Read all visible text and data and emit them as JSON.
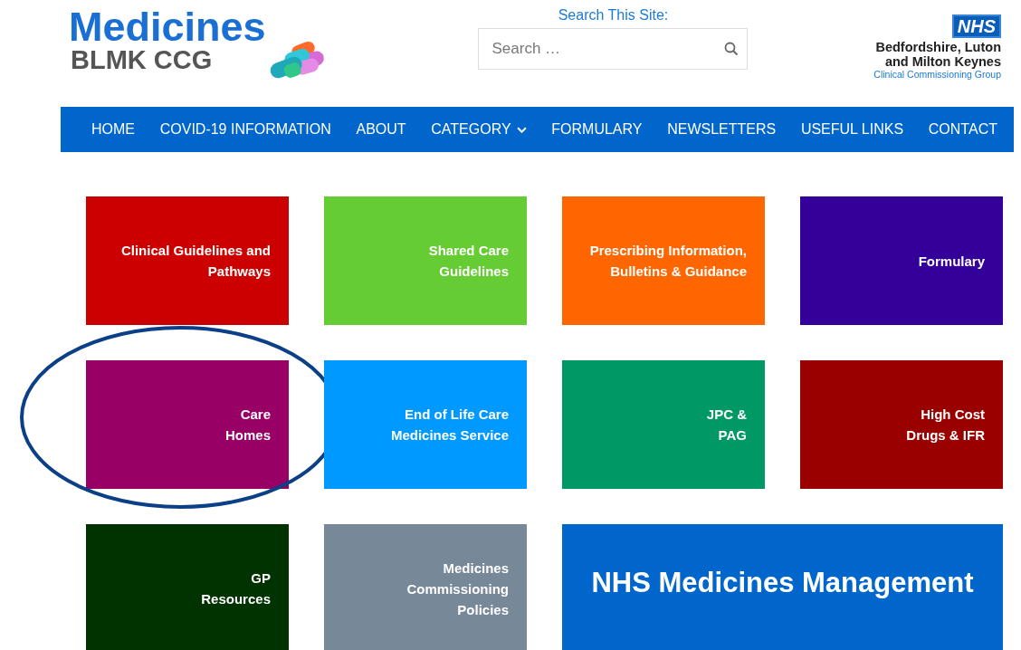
{
  "header": {
    "logo": {
      "title": "Medicines",
      "subtitle": "BLMK CCG"
    },
    "search": {
      "label": "Search This Site:",
      "placeholder": "Search …"
    },
    "org": {
      "badge": "NHS",
      "name_lines": [
        "Bedfordshire, Luton",
        "and Milton Keynes"
      ],
      "tagline": "Clinical Commissioning Group"
    }
  },
  "nav": [
    {
      "label": "HOME",
      "has_dropdown": false
    },
    {
      "label": "COVID-19 INFORMATION",
      "has_dropdown": false
    },
    {
      "label": "ABOUT",
      "has_dropdown": false
    },
    {
      "label": "CATEGORY",
      "has_dropdown": true
    },
    {
      "label": "FORMULARY",
      "has_dropdown": false
    },
    {
      "label": "NEWSLETTERS",
      "has_dropdown": false
    },
    {
      "label": "USEFUL LINKS",
      "has_dropdown": false
    },
    {
      "label": "CONTACT",
      "has_dropdown": false
    }
  ],
  "tiles": [
    {
      "kind": "link",
      "lines": [
        "Clinical Guidelines and",
        "Pathways"
      ],
      "color": "#cc0000",
      "highlighted": false
    },
    {
      "kind": "link",
      "lines": [
        "Shared Care",
        "Guidelines"
      ],
      "color": "#66cc33",
      "highlighted": false
    },
    {
      "kind": "link",
      "lines": [
        "Prescribing Information,",
        "Bulletins & Guidance"
      ],
      "color": "#ff6600",
      "highlighted": false
    },
    {
      "kind": "link",
      "lines": [
        "Formulary"
      ],
      "color": "#330099",
      "highlighted": false
    },
    {
      "kind": "link",
      "lines": [
        "Care",
        "Homes"
      ],
      "color": "#990066",
      "highlighted": true
    },
    {
      "kind": "link",
      "lines": [
        "End of Life Care",
        "Medicines Service"
      ],
      "color": "#0099ff",
      "highlighted": false
    },
    {
      "kind": "link",
      "lines": [
        "JPC &",
        "PAG"
      ],
      "color": "#009966",
      "highlighted": false
    },
    {
      "kind": "link",
      "lines": [
        "High Cost",
        "Drugs & IFR"
      ],
      "color": "#990000",
      "highlighted": false
    },
    {
      "kind": "link",
      "lines": [
        "GP",
        "Resources"
      ],
      "color": "#003300",
      "highlighted": false
    },
    {
      "kind": "link",
      "lines": [
        "Medicines",
        "Commissioning",
        "Policies"
      ],
      "color": "#778899",
      "highlighted": false
    },
    {
      "kind": "banner",
      "lines": [
        "NHS Medicines Management"
      ],
      "color": "#0066cc"
    }
  ]
}
